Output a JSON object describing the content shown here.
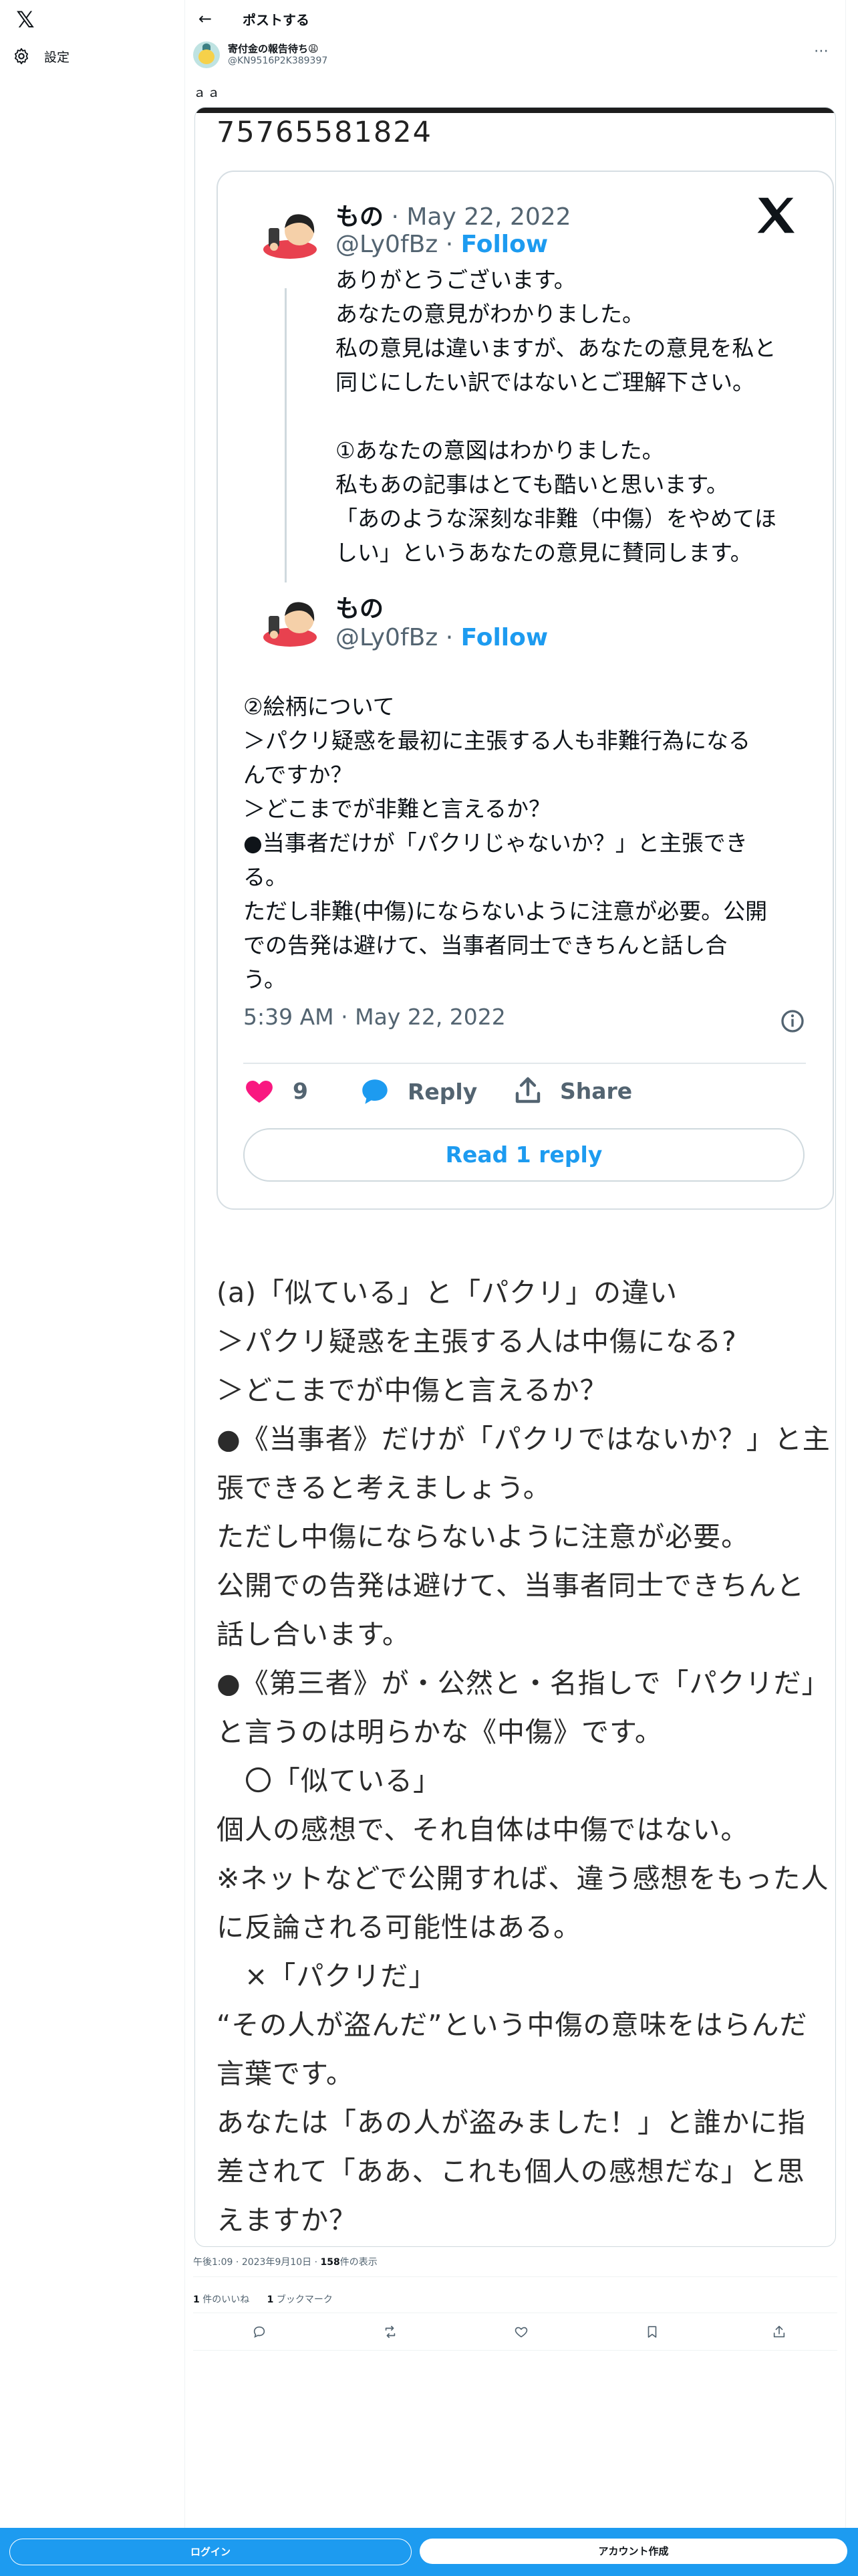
{
  "nav": {
    "settings_label": "設定"
  },
  "header": {
    "title": "ポストする"
  },
  "post": {
    "author_name": "寄付金の報告待ち😩",
    "author_handle": "@KN9516P2K389397",
    "more_icon": "⋯",
    "text": "ａａ",
    "image": {
      "id_number": "75765581824",
      "embed": {
        "author_name": "もの",
        "date": "May 22, 2022",
        "handle": "@Ly0fBz",
        "follow": "Follow",
        "sep": "·",
        "text1": "ありがとうございます。\nあなたの意見がわかりました。\n私の意見は違いますが、あなたの意見を私と\n同じにしたい訳ではないとご理解下さい。\n\n①あなたの意図はわかりました。\n私もあの記事はとても酷いと思います。\n「あのような深刻な非難（中傷）をやめてほ\nしい」というあなたの意見に賛同します。",
        "reply_author_name": "もの",
        "reply_handle": "@Ly0fBz",
        "text2": "②絵柄について\n＞パクリ疑惑を最初に主張する人も非難行為になる\nんですか？\n＞どこまでが非難と言えるか？\n●当事者だけが「パクリじゃないか？」と主張でき\nる。\nただし非難(中傷)にならないように注意が必要。公開\nでの告発は避けて、当事者同士できちんと話し合\nう。",
        "timestamp": "5:39 AM · May 22, 2022",
        "likes": "9",
        "reply_label": "Reply",
        "share_label": "Share",
        "read_reply": "Read 1 reply"
      },
      "explanation": [
        "(a)「似ている」と「パクリ」の違い",
        "＞パクリ疑惑を主張する人は中傷になる?",
        "＞どこまでが中傷と言えるか？",
        "●《当事者》だけが「パクリではないか？」と主",
        "張できると考えましょう。",
        "ただし中傷にならないように注意が必要。",
        "公開での告発は避けて、当事者同士できちんと",
        "話し合います。",
        "●《第三者》が・公然と・名指しで「パクリだ」",
        "と言うのは明らかな《中傷》です。",
        "　〇「似ている」",
        "個人の感想で、それ自体は中傷ではない。",
        "※ネットなどで公開すれば、違う感想をもった人",
        "に反論される可能性はある。",
        "　×「パクリだ」",
        "“その人が盗んだ”という中傷の意味をはらんだ",
        "言葉です。",
        "あなたは「あの人が盗みました！」と誰かに指",
        "差されて「ああ、これも個人の感想だな」と思",
        "えますか？"
      ]
    },
    "time": "午後1:09",
    "date": "2023年9月10日",
    "dot": "·",
    "views_count": "158",
    "views_label": "件の表示",
    "likes_count": "1",
    "likes_label": "件のいいね",
    "bookmarks_count": "1",
    "bookmarks_label": "ブックマーク"
  },
  "bottom_bar": {
    "login": "ログイン",
    "signup": "アカウント作成"
  },
  "colors": {
    "accent": "#1d9bf0",
    "heart": "#f91880"
  }
}
